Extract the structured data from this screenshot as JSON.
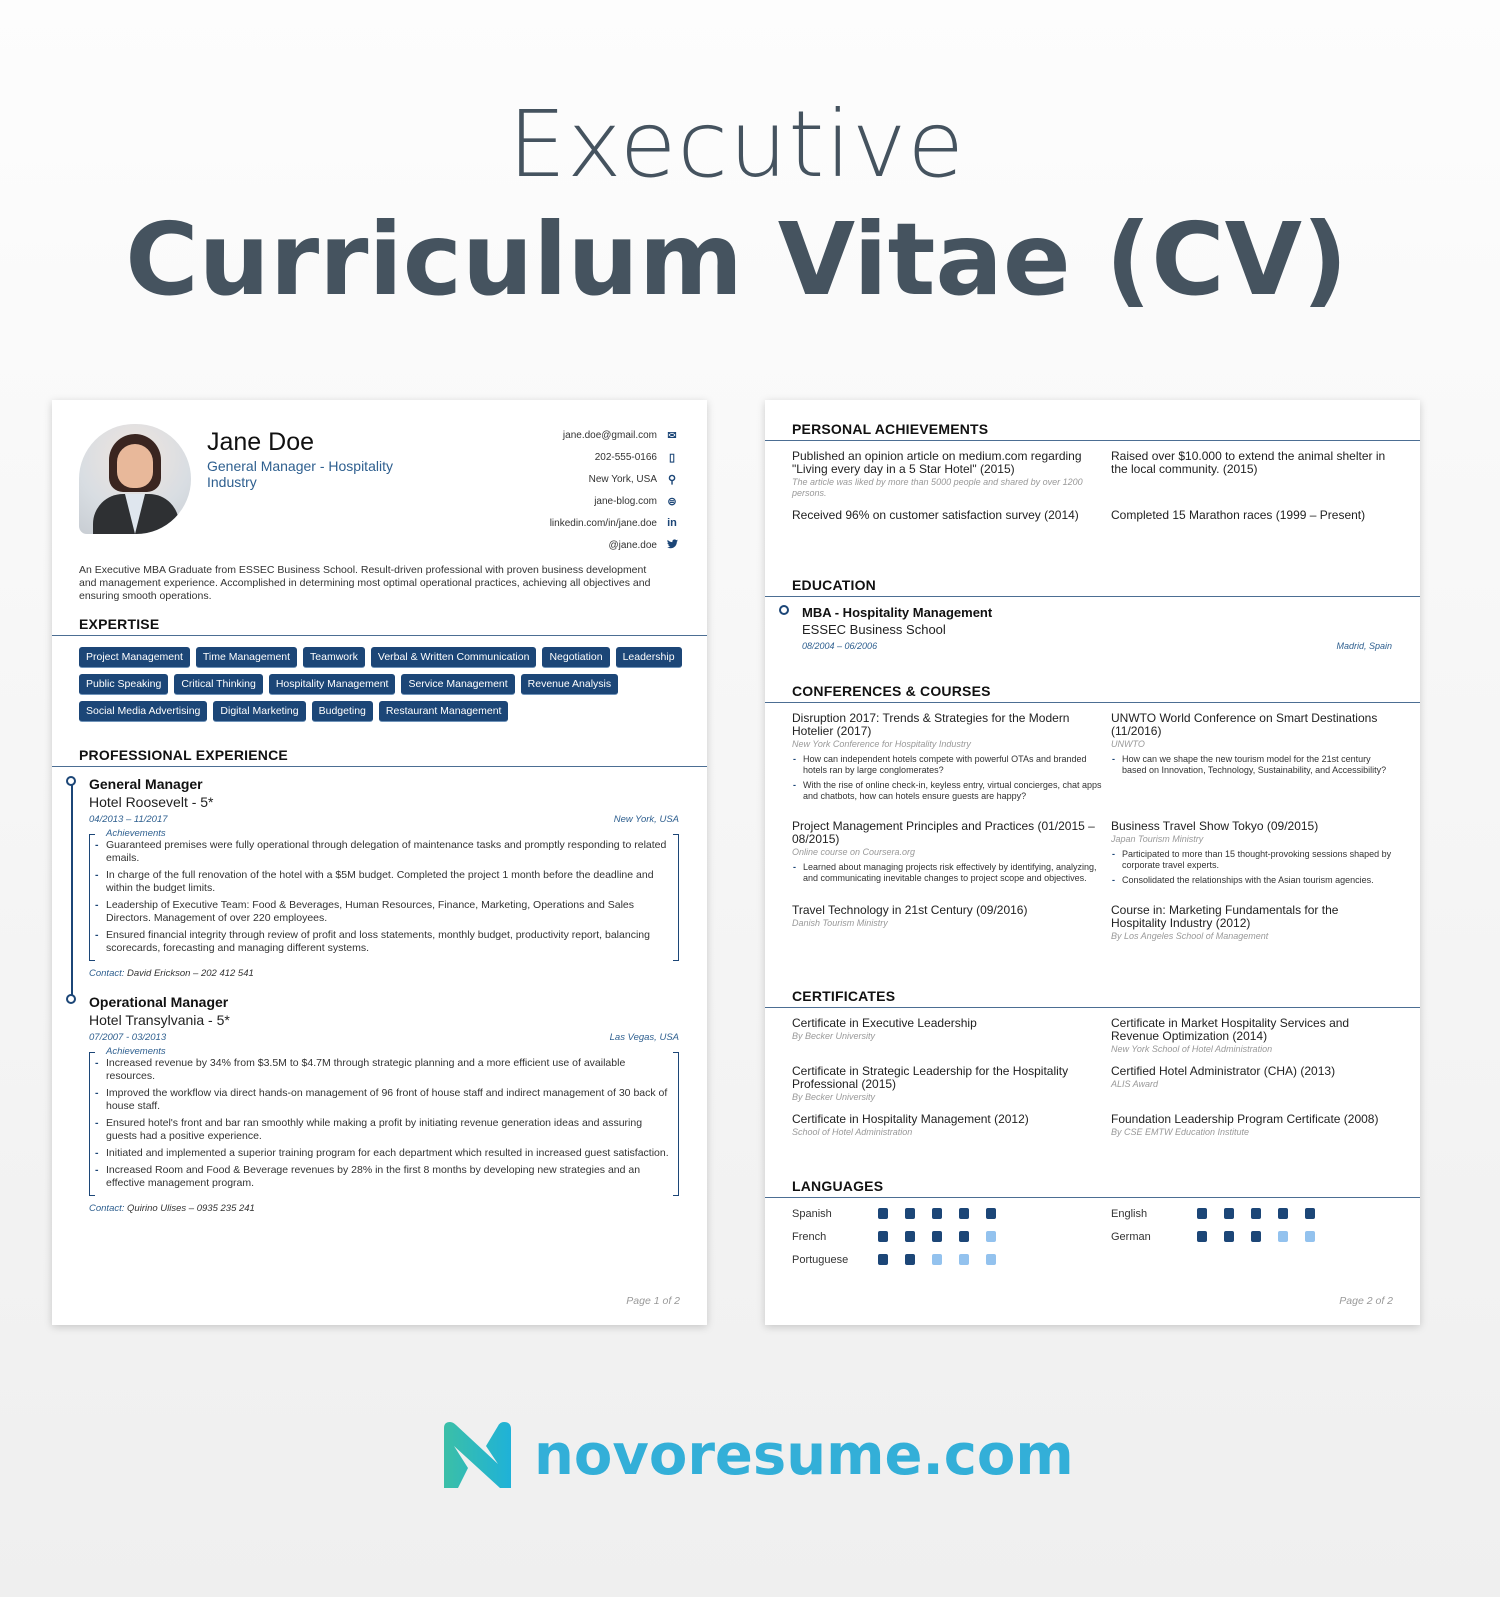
{
  "hero": {
    "line1": "Executive",
    "line2": "Curriculum Vitae (CV)"
  },
  "page1": {
    "header": {
      "name": "Jane Doe",
      "role": "General Manager - Hospitality Industry",
      "contacts": [
        {
          "text": "jane.doe@gmail.com",
          "icon": "envelope-icon",
          "glyph": "✉"
        },
        {
          "text": "202-555-0166",
          "icon": "phone-icon",
          "glyph": "▯"
        },
        {
          "text": "New York, USA",
          "icon": "location-pin-icon",
          "glyph": "⚲"
        },
        {
          "text": "jane-blog.com",
          "icon": "globe-icon",
          "glyph": "⊜"
        },
        {
          "text": "linkedin.com/in/jane.doe",
          "icon": "linkedin-icon",
          "glyph": "in"
        },
        {
          "text": "@jane.doe",
          "icon": "twitter-icon",
          "glyph": "🐦"
        }
      ]
    },
    "summary": "An Executive MBA Graduate from ESSEC Business School. Result-driven professional with proven business development and management experience. Accomplished in determining most optimal operational practices, achieving all objectives and ensuring smooth operations.",
    "expertise": {
      "title": "EXPERTISE",
      "tags": [
        "Project Management",
        "Time Management",
        "Teamwork",
        "Verbal & Written Communication",
        "Negotiation",
        "Leadership",
        "Public Speaking",
        "Critical Thinking",
        "Hospitality Management",
        "Service Management",
        "Revenue Analysis",
        "Social Media Advertising",
        "Digital Marketing",
        "Budgeting",
        "Restaurant Management"
      ]
    },
    "experience": {
      "title": "PROFESSIONAL EXPERIENCE",
      "jobs": [
        {
          "title": "General Manager",
          "company": "Hotel Roosevelt - 5*",
          "dates": "04/2013 – 11/2017",
          "location": "New York, USA",
          "achievements_label": "Achievements",
          "achievements": [
            "Guaranteed premises were fully operational through delegation of maintenance tasks and promptly responding to related emails.",
            "In charge of the full renovation of the hotel with a $5M budget. Completed the project 1 month before the deadline and within the budget limits.",
            "Leadership of Executive Team: Food & Beverages, Human Resources, Finance, Marketing, Operations and Sales Directors. Management of over 220 employees.",
            "Ensured financial integrity through review of profit and loss statements, monthly budget, productivity report, balancing scorecards, forecasting and managing different systems."
          ],
          "contact_label": "Contact:",
          "contact": "David Erickson – 202 412 541"
        },
        {
          "title": "Operational Manager",
          "company": "Hotel Transylvania - 5*",
          "dates": "07/2007 - 03/2013",
          "location": "Las Vegas, USA",
          "achievements_label": "Achievements",
          "achievements": [
            "Increased revenue by 34% from $3.5M to $4.7M through strategic planning and a more efficient use of available resources.",
            "Improved the workflow via direct hands-on management of 96 front of house staff and indirect management of 30 back of house staff.",
            "Ensured hotel's front and bar ran smoothly while making a profit by initiating revenue generation ideas and assuring guests had a positive experience.",
            "Initiated and implemented a superior training program for each department which resulted in increased guest satisfaction.",
            "Increased Room and Food & Beverage revenues by 28% in the first 8 months by developing new strategies and an effective management program."
          ],
          "contact_label": "Contact:",
          "contact": "Quirino Ulises – 0935 235 241"
        }
      ]
    },
    "page_number": "Page 1 of 2"
  },
  "page2": {
    "achievements": {
      "title": "PERSONAL ACHIEVEMENTS",
      "items": [
        {
          "title": "Published an opinion article on medium.com regarding \"Living every day in a 5 Star Hotel\" (2015)",
          "sub": "The article was liked by more than 5000 people and shared by over 1200 persons."
        },
        {
          "title": "Raised over $10.000 to extend the animal shelter in the local community. (2015)",
          "sub": ""
        },
        {
          "title": "Received 96% on customer satisfaction survey (2014)",
          "sub": ""
        },
        {
          "title": "Completed 15 Marathon races (1999 – Present)",
          "sub": ""
        }
      ]
    },
    "education": {
      "title": "EDUCATION",
      "degree": "MBA - Hospitality Management",
      "school": "ESSEC Business School",
      "dates": "08/2004 – 06/2006",
      "location": "Madrid, Spain"
    },
    "conferences": {
      "title": "CONFERENCES & COURSES",
      "items": [
        {
          "title": "Disruption 2017: Trends & Strategies for the Modern Hotelier (2017)",
          "sub": "New York Conference for Hospitality Industry",
          "bullets": [
            "How can independent hotels compete with powerful OTAs and branded hotels ran by large conglomerates?",
            "With the rise of online check-in, keyless entry, virtual concierges, chat apps and chatbots, how can hotels ensure guests are happy?"
          ]
        },
        {
          "title": "UNWTO World Conference on Smart Destinations (11/2016)",
          "sub": "UNWTO",
          "bullets": [
            "How can we shape the new tourism model for the 21st century based on Innovation, Technology, Sustainability, and Accessibility?"
          ]
        },
        {
          "title": "Project Management Principles and Practices (01/2015 – 08/2015)",
          "sub": "Online course on Coursera.org",
          "bullets": [
            "Learned about managing projects risk effectively by identifying, analyzing, and communicating inevitable changes to project scope and objectives."
          ]
        },
        {
          "title": "Business Travel Show Tokyo (09/2015)",
          "sub": "Japan Tourism Ministry",
          "bullets": [
            "Participated to more than 15 thought-provoking sessions shaped by corporate travel experts.",
            "Consolidated the relationships with the Asian tourism agencies."
          ]
        },
        {
          "title": "Travel Technology in 21st Century (09/2016)",
          "sub": "Danish Tourism Ministry",
          "bullets": []
        },
        {
          "title": "Course in: Marketing Fundamentals for the Hospitality Industry (2012)",
          "sub": "By Los Angeles School of Management",
          "bullets": []
        }
      ]
    },
    "certificates": {
      "title": "CERTIFICATES",
      "items": [
        {
          "title": "Certificate in Executive Leadership",
          "sub": "By Becker University"
        },
        {
          "title": "Certificate in Market Hospitality Services and Revenue Optimization (2014)",
          "sub": "New York School of Hotel Administration"
        },
        {
          "title": "Certificate in Strategic Leadership for the Hospitality Professional (2015)",
          "sub": "By Becker University"
        },
        {
          "title": "Certified Hotel Administrator (CHA) (2013)",
          "sub": "ALIS Award"
        },
        {
          "title": "Certificate in Hospitality Management (2012)",
          "sub": "School of Hotel Administration"
        },
        {
          "title": "Foundation Leadership Program Certificate (2008)",
          "sub": "By CSE EMTW Education Institute"
        }
      ]
    },
    "languages": {
      "title": "LANGUAGES",
      "max_level": 5,
      "left": [
        {
          "name": "Spanish",
          "level": 5
        },
        {
          "name": "French",
          "level": 4
        },
        {
          "name": "Portuguese",
          "level": 2
        }
      ],
      "right": [
        {
          "name": "English",
          "level": 5
        },
        {
          "name": "German",
          "level": 3
        }
      ]
    },
    "page_number": "Page 2 of 2"
  },
  "brand": {
    "text": "novoresume.com",
    "colors": {
      "primary": "#33afd8",
      "gradient_start": "#3bbfa7"
    }
  },
  "colors": {
    "accent": "#1c4677",
    "light_accent": "#93c2ee",
    "hero_text": "#45535f"
  }
}
